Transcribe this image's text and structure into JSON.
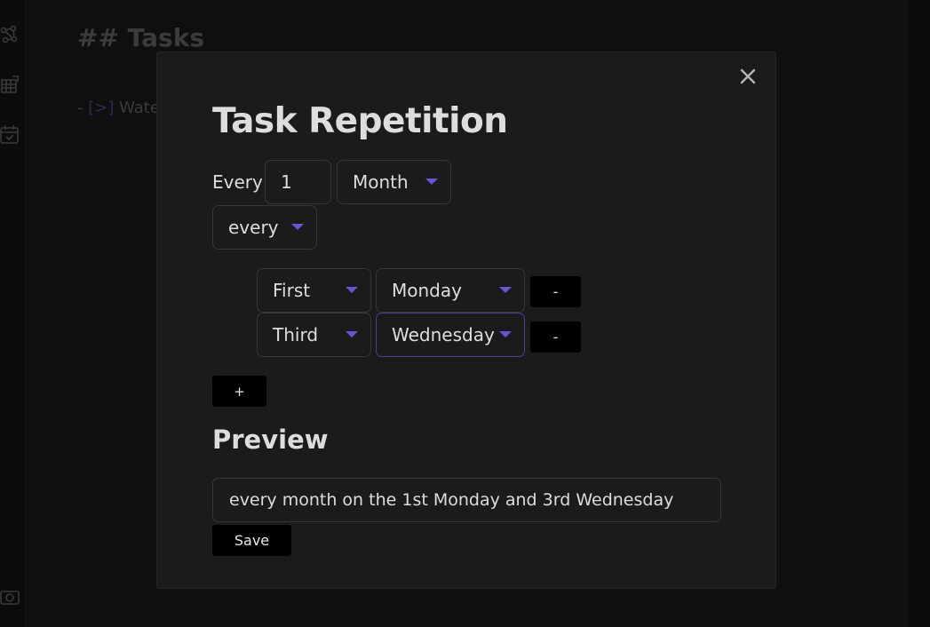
{
  "background": {
    "heading": "## Tasks",
    "task_prefix": "- ",
    "task_checkbox": "[>]",
    "task_text": " Wate"
  },
  "modal": {
    "title": "Task Repetition",
    "every_label": "Every",
    "interval_value": "1",
    "period_select": "Month",
    "mode_select": "every",
    "rules": [
      {
        "ordinal": "First",
        "weekday": "Monday",
        "remove_label": "-"
      },
      {
        "ordinal": "Third",
        "weekday": "Wednesday",
        "remove_label": "-"
      }
    ],
    "add_label": "+",
    "preview_heading": "Preview",
    "preview_text": "every month on the 1st Monday and 3rd Wednesday",
    "save_label": "Save"
  },
  "icons": {
    "ribbon": [
      "graph-view-icon",
      "canvas-grid-icon",
      "calendar-icon",
      "camera-icon"
    ],
    "close": "close-icon",
    "dropdown": "chevron-down-icon"
  },
  "colors": {
    "accent": "#6b52d9",
    "focus_border": "#4a3f9a",
    "modal_bg": "#1b1b1b",
    "page_bg": "#0f0f0f",
    "button_bg": "#000000"
  }
}
